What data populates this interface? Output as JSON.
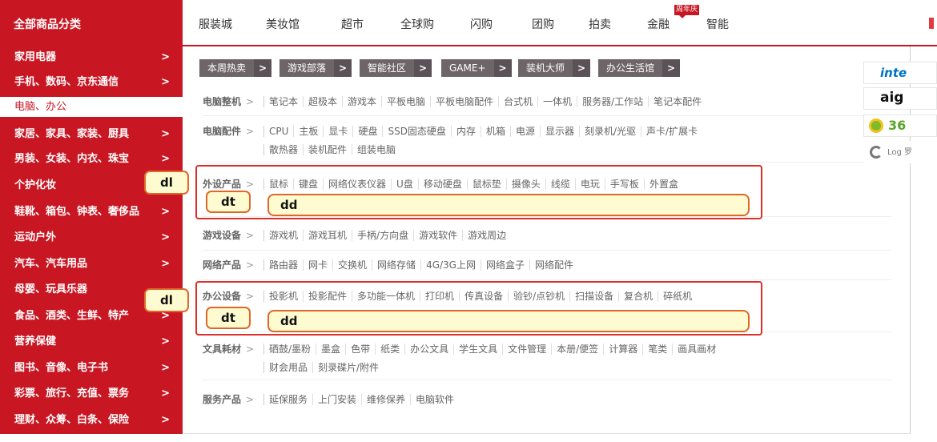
{
  "header": {
    "all_categories": "全部商品分类",
    "nav": [
      "服装城",
      "美妆馆",
      "超市",
      "全球购",
      "闪购",
      "团购",
      "拍卖",
      "金融",
      "智能"
    ],
    "badge": "周年庆"
  },
  "sidebar": {
    "items": [
      {
        "label": "家用电器",
        "arrow": ">"
      },
      {
        "label": "手机、数码、京东通信",
        "arrow": ">"
      },
      {
        "label": "电脑、办公",
        "arrow": ""
      },
      {
        "label": "家居、家具、家装、厨具",
        "arrow": ">"
      },
      {
        "label": "男装、女装、内衣、珠宝",
        "arrow": ">"
      },
      {
        "label": "个护化妆",
        "arrow": ""
      },
      {
        "label": "鞋靴、箱包、钟表、奢侈品",
        "arrow": ">"
      },
      {
        "label": "运动户外",
        "arrow": ">"
      },
      {
        "label": "汽车、汽车用品",
        "arrow": ">"
      },
      {
        "label": "母婴、玩具乐器",
        "arrow": ""
      },
      {
        "label": "食品、酒类、生鲜、特产",
        "arrow": ">"
      },
      {
        "label": "营养保健",
        "arrow": ">"
      },
      {
        "label": "图书、音像、电子书",
        "arrow": ">"
      },
      {
        "label": "彩票、旅行、充值、票务",
        "arrow": ">"
      },
      {
        "label": "理财、众筹、白条、保险",
        "arrow": ">"
      }
    ]
  },
  "channels": [
    {
      "label": "本周热卖",
      "caret": ">"
    },
    {
      "label": "游戏部落",
      "caret": ">"
    },
    {
      "label": "智能社区",
      "caret": ">"
    },
    {
      "label": "GAME+",
      "caret": ">"
    },
    {
      "label": "装机大师",
      "caret": ">"
    },
    {
      "label": "办公生活馆",
      "caret": ">"
    }
  ],
  "rows": [
    {
      "title": "电脑整机",
      "gt": ">",
      "lines": [
        [
          "笔记本",
          "超极本",
          "游戏本",
          "平板电脑",
          "平板电脑配件",
          "台式机",
          "一体机",
          "服务器/工作站",
          "笔记本配件"
        ]
      ]
    },
    {
      "title": "电脑配件",
      "gt": ">",
      "lines": [
        [
          "CPU",
          "主板",
          "显卡",
          "硬盘",
          "SSD固态硬盘",
          "内存",
          "机箱",
          "电源",
          "显示器",
          "刻录机/光驱",
          "声卡/扩展卡"
        ],
        [
          "散热器",
          "装机配件",
          "组装电脑"
        ]
      ]
    },
    {
      "title": "外设产品",
      "gt": ">",
      "lines": [
        [
          "鼠标",
          "键盘",
          "网络仪表仪器",
          "U盘",
          "移动硬盘",
          "鼠标垫",
          "摄像头",
          "线缆",
          "电玩",
          "手写板",
          "外置盒"
        ]
      ]
    },
    {
      "title": "游戏设备",
      "gt": ">",
      "lines": [
        [
          "游戏机",
          "游戏耳机",
          "手柄/方向盘",
          "游戏软件",
          "游戏周边"
        ]
      ]
    },
    {
      "title": "网络产品",
      "gt": ">",
      "lines": [
        [
          "路由器",
          "网卡",
          "交换机",
          "网络存储",
          "4G/3G上网",
          "网络盒子",
          "网络配件"
        ]
      ]
    },
    {
      "title": "办公设备",
      "gt": ">",
      "lines": [
        [
          "投影机",
          "投影配件",
          "多功能一体机",
          "打印机",
          "传真设备",
          "验钞/点钞机",
          "扫描设备",
          "复合机",
          "碎纸机"
        ]
      ]
    },
    {
      "title": "文具耗材",
      "gt": ">",
      "lines": [
        [
          "硒鼓/墨粉",
          "墨盒",
          "色带",
          "纸类",
          "办公文具",
          "学生文具",
          "文件管理",
          "本册/便签",
          "计算器",
          "笔类",
          "画具画材"
        ],
        [
          "财会用品",
          "刻录碟片/附件"
        ]
      ]
    },
    {
      "title": "服务产品",
      "gt": ">",
      "lines": [
        [
          "延保服务",
          "上门安装",
          "维修保养",
          "电脑软件"
        ]
      ]
    }
  ],
  "annotations": {
    "dl": "dl",
    "dt": "dt",
    "dd": "dd"
  },
  "brands": [
    {
      "name": "intel-logo",
      "text": "inte"
    },
    {
      "name": "aigo-logo",
      "text": "aig"
    },
    {
      "name": "360-logo",
      "text": "36"
    },
    {
      "name": "logitech-logo",
      "text": "Log 罗"
    }
  ],
  "colors": {
    "brand_red": "#c81623",
    "channel_bg": "#6e6568",
    "annotation_red": "#d9312a",
    "annotation_fill": "#fffbd0"
  }
}
